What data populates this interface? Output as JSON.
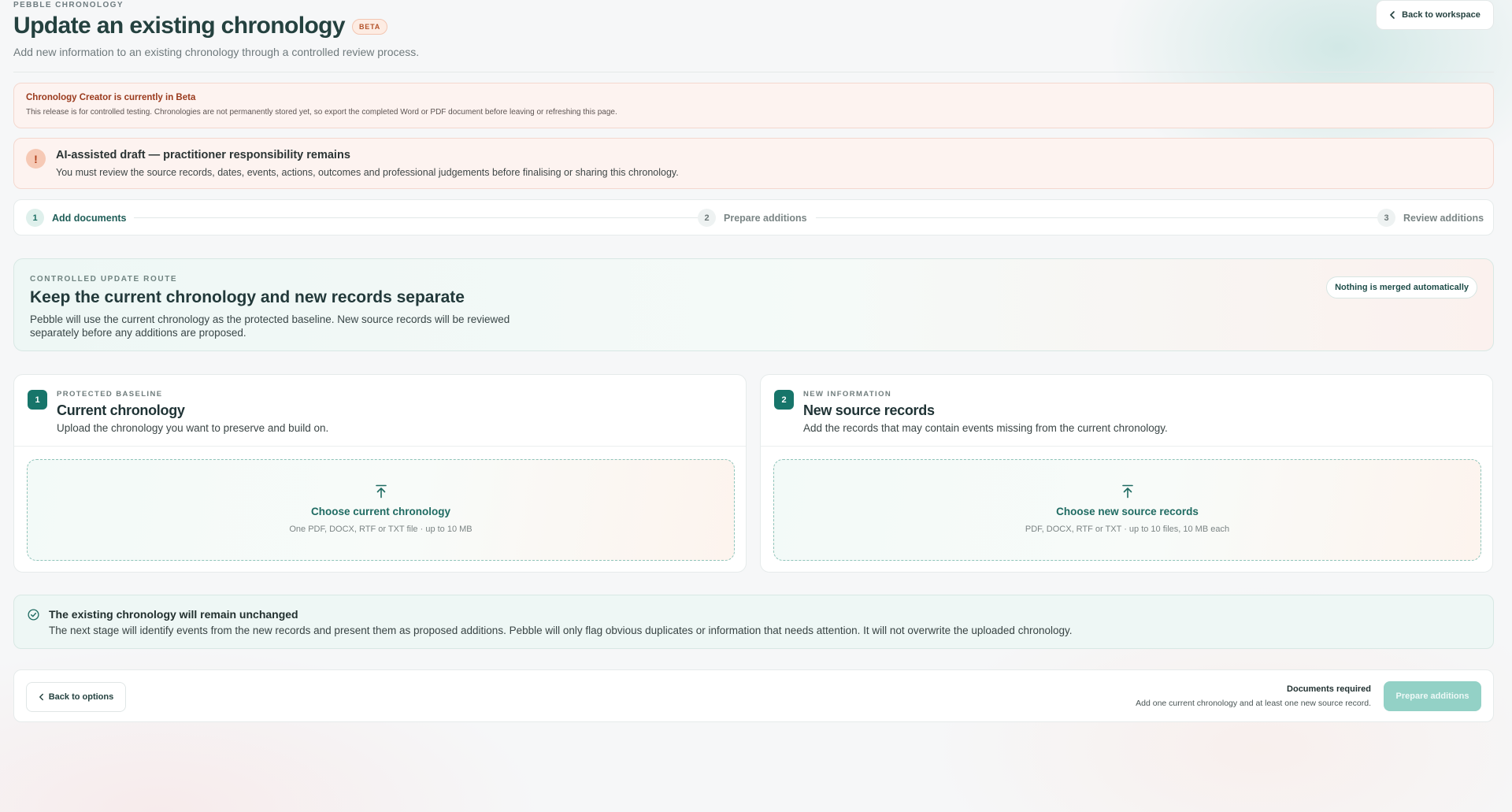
{
  "header": {
    "brand": "PEBBLE CHRONOLOGY",
    "title": "Update an existing chronology",
    "badge": "BETA",
    "subtitle": "Add new information to an existing chronology through a controlled review process.",
    "back_label": "Back to workspace",
    "back_icon": "chevron-left-icon"
  },
  "beta_notice": {
    "title": "Chronology Creator is currently in Beta",
    "text": "This release is for controlled testing. Chronologies are not permanently stored yet, so export the completed Word or PDF document before leaving or refreshing this page."
  },
  "ai_warning": {
    "icon": "!",
    "title": "AI-assisted draft — practitioner responsibility remains",
    "text": "You must review the source records, dates, events, actions, outcomes and professional judgements before finalising or sharing this chronology."
  },
  "stepper": {
    "steps": [
      {
        "number": "1",
        "label": "Add documents",
        "active": true
      },
      {
        "number": "2",
        "label": "Prepare additions",
        "active": false
      },
      {
        "number": "3",
        "label": "Review additions",
        "active": false
      }
    ]
  },
  "route": {
    "eyebrow": "CONTROLLED UPDATE ROUTE",
    "title": "Keep the current chronology and new records separate",
    "text": "Pebble will use the current chronology as the protected baseline. New source records will be reviewed separately before any additions are proposed.",
    "badge": "Nothing is merged automatically"
  },
  "cards": [
    {
      "number": "1",
      "eyebrow": "PROTECTED BASELINE",
      "title": "Current chronology",
      "description": "Upload the chronology you want to preserve and build on.",
      "drop_title": "Choose current chronology",
      "drop_hint": "One PDF, DOCX, RTF or TXT file · up to 10 MB",
      "icon": "upload-icon"
    },
    {
      "number": "2",
      "eyebrow": "NEW INFORMATION",
      "title": "New source records",
      "description": "Add the records that may contain events missing from the current chronology.",
      "drop_title": "Choose new source records",
      "drop_hint": "PDF, DOCX, RTF or TXT · up to 10 files, 10 MB each",
      "icon": "upload-icon"
    }
  ],
  "unchanged": {
    "title": "The existing chronology will remain unchanged",
    "text": "The next stage will identify events from the new records and present them as proposed additions. Pebble will only flag obvious duplicates or information that needs attention. It will not overwrite the uploaded chronology.",
    "icon": "check-circle-icon"
  },
  "footer": {
    "back_label": "Back to options",
    "req_title": "Documents required",
    "req_text": "Add one current chronology and at least one new source record.",
    "primary_label": "Prepare additions",
    "primary_disabled": true
  },
  "colors": {
    "accent": "#17756a",
    "accent_disabled": "#93d1c6",
    "warning_bg": "#fdf3f0",
    "warning_text": "#9a3a1d"
  }
}
